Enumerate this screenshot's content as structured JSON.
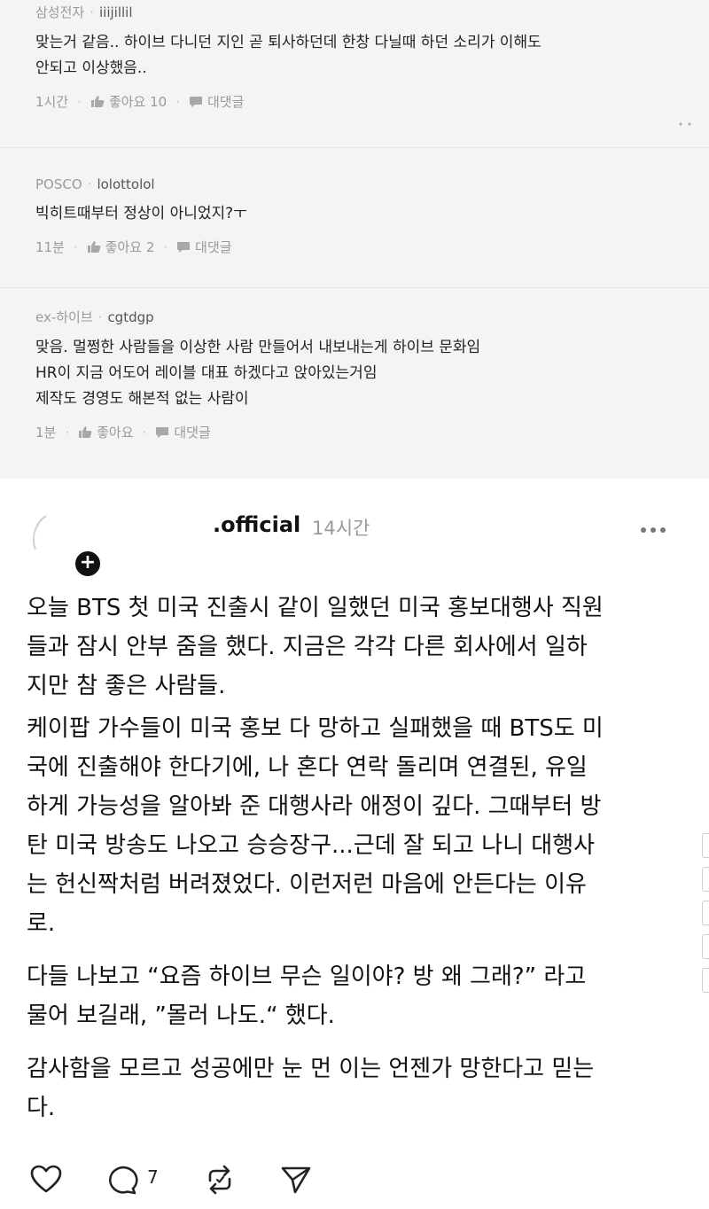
{
  "comments": [
    {
      "company": "삼성전자",
      "nickname": "iiijillil",
      "text": "맞는거 같음.. 하이브 다니던 지인 곧 퇴사하던데 한창 다닐때 하던 소리가 이해도\n안되고 이상했음..",
      "time": "1시간",
      "like_label": "좋아요 10",
      "reply_label": "대댓글"
    },
    {
      "company": "POSCO",
      "nickname": "lolottolol",
      "text": "빅히트때부터 정상이 아니었지?ㅜ",
      "time": "11분",
      "like_label": "좋아요 2",
      "reply_label": "대댓글"
    },
    {
      "company": "ex-하이브",
      "nickname": "cgtdgp",
      "text": "맞음. 멀쩡한 사람들을 이상한 사람 만들어서 내보내는게 하이브 문화임\nHR이 지금 어도어 레이블 대표 하겠다고 앉아있는거임\n제작도 경영도 해본적 없는 사람이",
      "time": "1분",
      "like_label": "좋아요",
      "reply_label": "대댓글"
    }
  ],
  "post": {
    "username": ".official",
    "time": "14시간",
    "paragraphs": [
      "오늘 BTS 첫 미국 진출시 같이 일했던 미국 홍보대행사 직원\n들과 잠시 안부 줌을 했다. 지금은 각각 다른 회사에서 일하\n지만 참 좋은 사람들.",
      "케이팝 가수들이 미국 홍보 다 망하고 실패했을 때 BTS도 미\n국에 진출해야 한다기에, 나 혼다 연락 돌리며 연결된, 유일\n하게 가능성을 알아봐 준 대행사라 애정이 깊다. 그때부터 방\n탄 미국 방송도 나오고 승승장구...근데 잘 되고 나니 대행사\n는 헌신짝처럼 버려졌었다. 이런저런 마음에 안든다는 이유\n로.",
      "다들 나보고 “요즘 하이브 무슨 일이야? 방 왜 그래?” 라고\n물어 보길래, ”몰러 나도.“ 했다.",
      "감사함을 모르고 성공에만 눈 먼 이는 언젠가 망한다고 믿는\n다."
    ],
    "comment_count": "7"
  }
}
